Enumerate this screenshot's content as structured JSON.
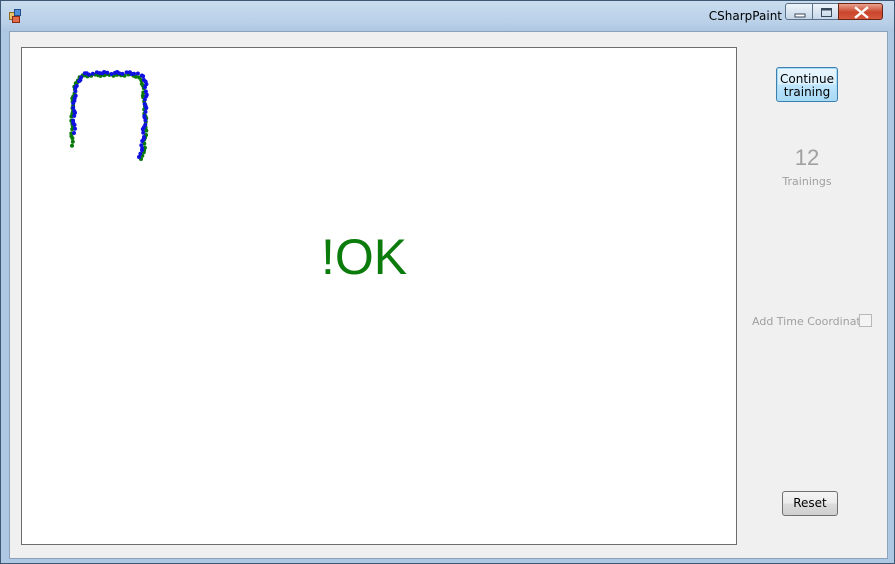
{
  "window": {
    "title": "CSharpPaint"
  },
  "canvas": {
    "result_text": "!OK",
    "result_color": "#0b7c0b",
    "stroke_colors": [
      "#0a7a0a",
      "#1010e0"
    ],
    "icons": [
      "app-icon",
      "minimize-icon",
      "maximize-icon",
      "close-icon"
    ]
  },
  "sidebar": {
    "continue_label": "Continue\ntraining",
    "training_count": "12",
    "training_label": "Trainings",
    "time_coordinate_label": "Add Time Coordinate",
    "time_coordinate_checked": false,
    "reset_label": "Reset"
  }
}
